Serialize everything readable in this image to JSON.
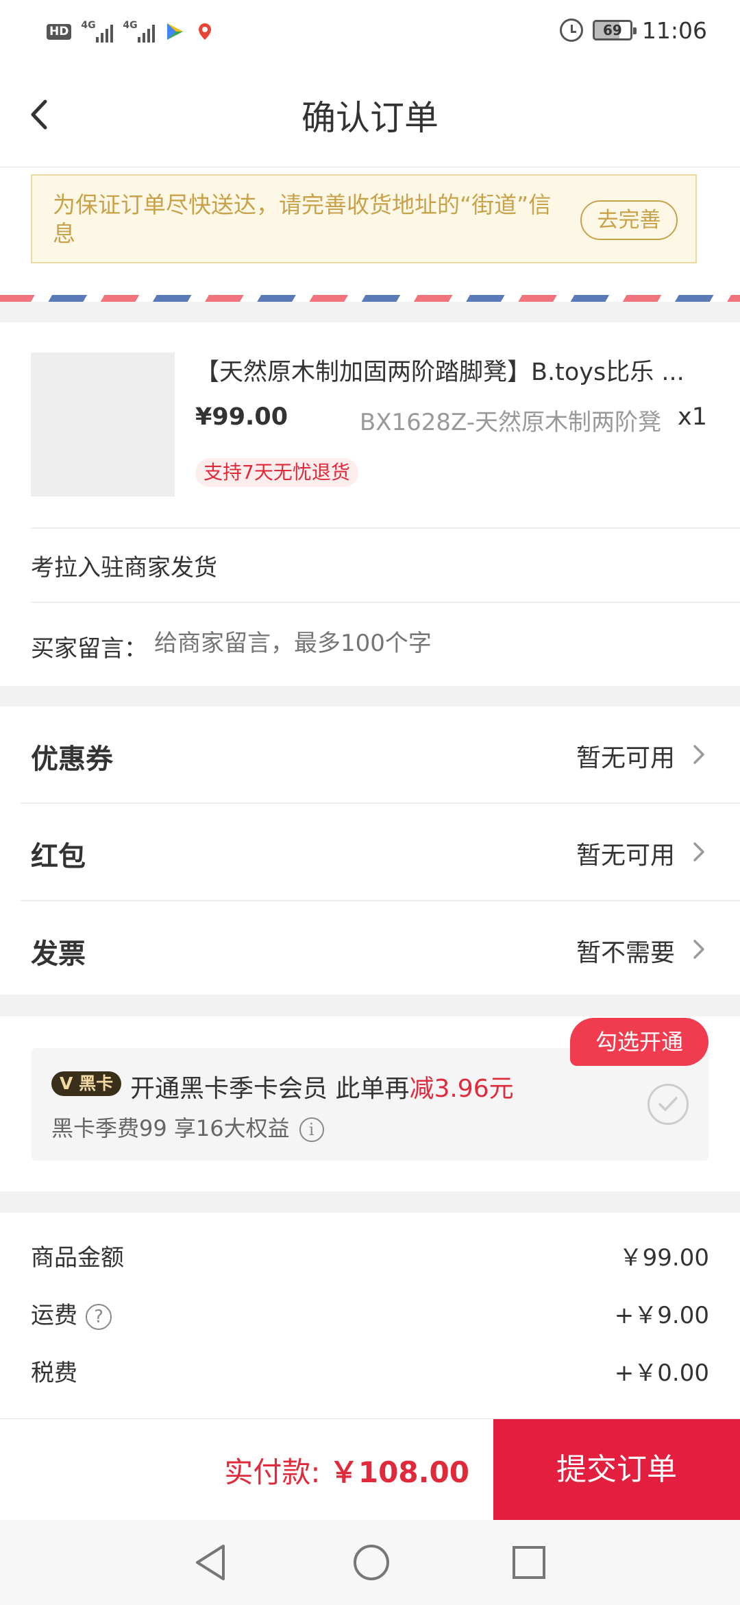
{
  "statusbar": {
    "hd": "HD",
    "net1": "4G",
    "net2": "4G",
    "battery": "69",
    "time": "11:06"
  },
  "header": {
    "title": "确认订单"
  },
  "notice": {
    "text": "为保证订单尽快送达，请完善收货地址的“街道”信息",
    "button": "去完善"
  },
  "product": {
    "name": "【天然原木制加固两阶踏脚凳】B.toys比乐 ...",
    "price": "¥99.00",
    "spec": "BX1628Z-天然原木制两阶凳",
    "qty": "x1",
    "tag": "支持7天无忧退货",
    "shipper": "考拉入驻商家发货",
    "message_label": "买家留言：",
    "message_placeholder": "给商家留言，最多100个字"
  },
  "options": [
    {
      "label": "优惠券",
      "value": "暂无可用"
    },
    {
      "label": "红包",
      "value": "暂无可用"
    },
    {
      "label": "发票",
      "value": "暂不需要"
    }
  ],
  "member": {
    "badge": "黑卡",
    "title": "开通黑卡季卡会员 此单再",
    "discount": "减3.96元",
    "subtitle": "黑卡季费99 享16大权益",
    "bubble": "勾选开通"
  },
  "summary": {
    "rows": [
      {
        "label": "商品金额",
        "value": "￥99.00"
      },
      {
        "label": "运费",
        "value": "+￥9.00"
      },
      {
        "label": "税费",
        "value": "+￥0.00"
      }
    ]
  },
  "bottom": {
    "pay_label": "实付款:",
    "pay_amount": "￥108.00",
    "submit": "提交订单"
  },
  "colors": {
    "accent": "#e41e3f",
    "notice_text": "#c8a24a",
    "notice_bg": "#fdf8e6"
  }
}
